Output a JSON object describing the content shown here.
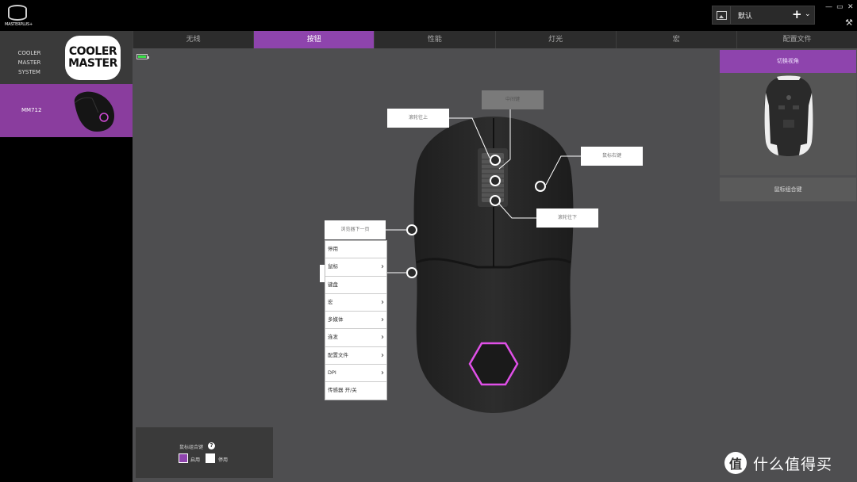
{
  "app": {
    "logo_label": "MASTERPLUS+"
  },
  "profile": {
    "name": "默认",
    "add_label": "+",
    "dropdown": "⌄"
  },
  "window": {
    "minimize": "—",
    "restore": "▭",
    "close": "✕",
    "tools": "⚒"
  },
  "sidebar": {
    "system_label_1": "COOLER MASTER",
    "system_label_2": "SYSTEM",
    "brand_logo_line1": "COOLER",
    "brand_logo_line2": "MASTER",
    "device_label": "MM712"
  },
  "tabs": [
    "无线",
    "按钮",
    "性能",
    "灯光",
    "宏",
    "配置文件"
  ],
  "active_tab": "按钮",
  "battery_level": 1.0,
  "callouts": {
    "scroll_up": "滚轮往上",
    "middle": "中间键",
    "right_click": "鼠标右键",
    "scroll_down": "滚轮往下",
    "browser_forward": "浏览器下一页"
  },
  "menu": [
    {
      "label": "停用",
      "submenu": false
    },
    {
      "label": "鼠标",
      "submenu": true
    },
    {
      "label": "键盘",
      "submenu": false
    },
    {
      "label": "宏",
      "submenu": true
    },
    {
      "label": "多媒体",
      "submenu": true
    },
    {
      "label": "连发",
      "submenu": true
    },
    {
      "label": "配置文件",
      "submenu": true
    },
    {
      "label": "DPI",
      "submenu": true
    },
    {
      "label": "传感器 开/关",
      "submenu": false
    }
  ],
  "right_panel": {
    "switch_view": "切换视角",
    "mouse_combo": "鼠标组合键"
  },
  "bottom_panel": {
    "title": "鼠标组合键",
    "help": "?",
    "enable": "启用",
    "disable": "停用",
    "enabled": true
  },
  "watermark": {
    "icon": "值",
    "text": "什么值得买"
  },
  "colors": {
    "accent": "#8e44ad",
    "battery": "#3be04a",
    "led": "#d04ad6"
  }
}
